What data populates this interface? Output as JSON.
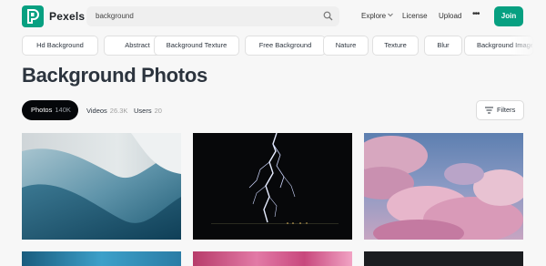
{
  "header": {
    "logo_letter": "P",
    "logo_text": "Pexels",
    "search_value": "background",
    "nav": {
      "explore": "Explore",
      "license": "License",
      "upload": "Upload",
      "more": "•••"
    },
    "join_label": "Join",
    "brand_color": "#07a081"
  },
  "chips": [
    "Hd Background",
    "Abstract",
    "Background Texture",
    "Free Background",
    "Nature",
    "Texture",
    "Blur",
    "Background Images"
  ],
  "main": {
    "title": "Background Photos",
    "tabs": {
      "photos": {
        "label": "Photos",
        "count": "140K"
      },
      "videos": {
        "label": "Videos",
        "count": "26.3K"
      },
      "users": {
        "label": "Users",
        "count": "20"
      }
    },
    "filters_label": "Filters"
  },
  "photos": [
    {
      "subject": "abstract blue curves"
    },
    {
      "subject": "lightning over water at night"
    },
    {
      "subject": "pink sunset clouds"
    },
    {
      "subject": "blue ocean wave"
    },
    {
      "subject": "pink flowers"
    },
    {
      "subject": "dark scene"
    }
  ]
}
